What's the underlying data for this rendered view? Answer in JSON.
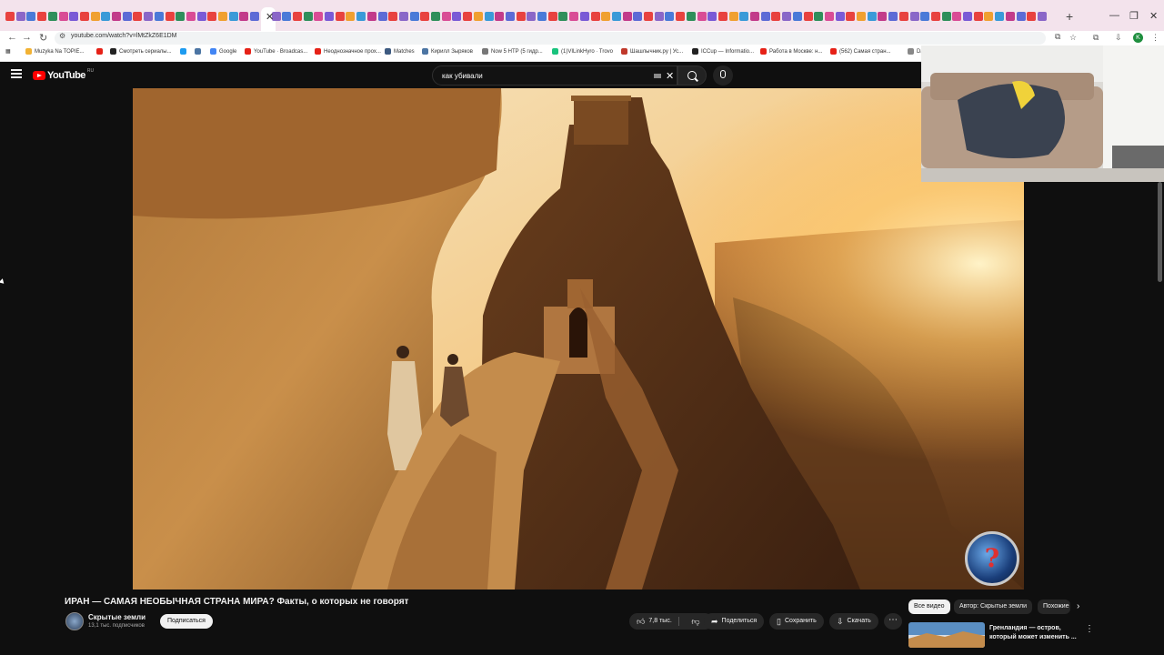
{
  "browser": {
    "url": "youtube.com/watch?v=lMtZkZ6E1DM",
    "tab_colors": [
      "#e8423f",
      "#8a67c8",
      "#4a7ad8",
      "#e8423f",
      "#2f8f5b",
      "#d94c95",
      "#7a5ad6",
      "#e8423f",
      "#f0a030",
      "#3a9ad8",
      "#c23b8a",
      "#5d6bd6"
    ],
    "bookmarks": [
      {
        "label": "Muzyka Na TOPIE...",
        "color": "#f2b233"
      },
      {
        "label": "",
        "color": "#e62117"
      },
      {
        "label": "Смотреть сериалы...",
        "color": "#222222"
      },
      {
        "label": "",
        "color": "#1d9bf0"
      },
      {
        "label": "",
        "color": "#4c75a3"
      },
      {
        "label": "Google",
        "color": "#4285f4"
      },
      {
        "label": "YouTube · Broadcas...",
        "color": "#e62117"
      },
      {
        "label": "Неоднозначное прох...",
        "color": "#e62117"
      },
      {
        "label": "Matches",
        "color": "#3d5a80"
      },
      {
        "label": "Кирилл Зыряков",
        "color": "#4c75a3"
      },
      {
        "label": "Now 5 НТР (5 гидр...",
        "color": "#777777"
      },
      {
        "label": "(1)VILinkHyro · Trovo",
        "color": "#19c37d"
      },
      {
        "label": "Шашлычник.ру | Ус...",
        "color": "#c0392b"
      },
      {
        "label": "ICCup — Informatio...",
        "color": "#222222"
      },
      {
        "label": "Работа в Москве: н...",
        "color": "#e62117"
      },
      {
        "label": "(562) Самая стран...",
        "color": "#e62117"
      },
      {
        "label": "Das",
        "color": "#888888"
      }
    ],
    "icons": {
      "back": "back-arrow-icon",
      "forward": "forward-arrow-icon",
      "reload": "reload-icon",
      "star": "star-icon",
      "extensions": "puzzle-icon",
      "profile": "K"
    }
  },
  "youtube": {
    "logo_text": "YouTube",
    "region": "RU",
    "search_query": "как убивали",
    "video": {
      "title": "ИРАН — САМАЯ НЕОБЫЧНАЯ СТРАНА МИРА? Факты, о которых не говорят",
      "channel": "Скрытые земли",
      "subscribers": "13,1 тыс. подписчиков",
      "subscribe_label": "Подписаться",
      "likes": "7,8 тыс.",
      "share_label": "Поделиться",
      "save_label": "Сохранить",
      "download_label": "Скачать",
      "watermark_symbol": "?"
    },
    "chips": {
      "all": "Все видео",
      "author": "Автор: Скрытые земли",
      "similar": "Похожие"
    },
    "recommendation": {
      "title": "Гренландия — остров, который может изменить ..."
    }
  },
  "colors": {
    "brand_red": "#ff0000",
    "background": "#0f0f0f",
    "pill": "#272727"
  }
}
